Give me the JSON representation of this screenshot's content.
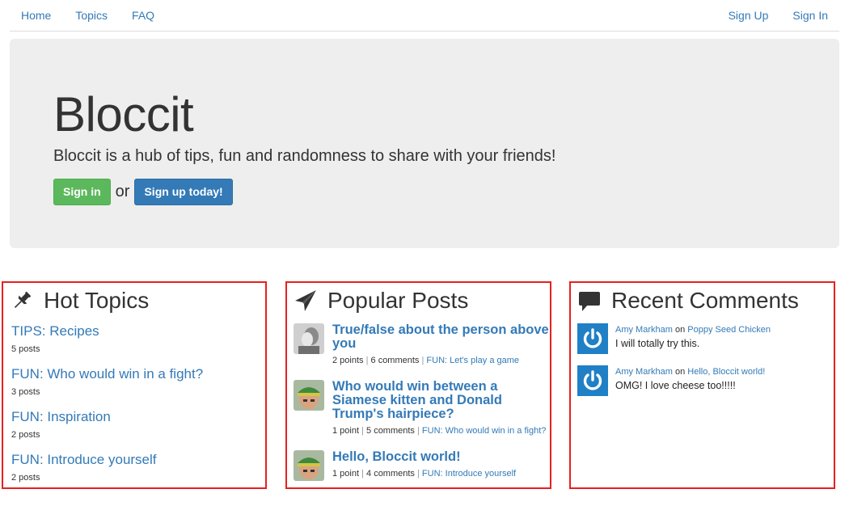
{
  "nav": {
    "left": [
      {
        "label": "Home"
      },
      {
        "label": "Topics"
      },
      {
        "label": "FAQ"
      }
    ],
    "right": [
      {
        "label": "Sign Up"
      },
      {
        "label": "Sign In"
      }
    ]
  },
  "hero": {
    "title": "Bloccit",
    "tagline": "Bloccit is a hub of tips, fun and randomness to share with your friends!",
    "sign_in_label": "Sign in",
    "or_text": "or",
    "sign_up_label": "Sign up today!"
  },
  "hot_topics": {
    "heading": "Hot Topics",
    "icon": "pushpin-icon",
    "items": [
      {
        "name": "TIPS: Recipes",
        "count": "5 posts"
      },
      {
        "name": "FUN: Who would win in a fight?",
        "count": "3 posts"
      },
      {
        "name": "FUN: Inspiration",
        "count": "2 posts"
      },
      {
        "name": "FUN: Introduce yourself",
        "count": "2 posts"
      }
    ]
  },
  "popular_posts": {
    "heading": "Popular Posts",
    "icon": "paper-plane-icon",
    "items": [
      {
        "title": "True/false about the person above you",
        "points": "2 points",
        "comments": "6 comments",
        "topic": "FUN: Let's play a game"
      },
      {
        "title": "Who would win between a Siamese kitten and Donald Trump's hairpiece?",
        "points": "1 point",
        "comments": "5 comments",
        "topic": "FUN: Who would win in a fight?"
      },
      {
        "title": "Hello, Bloccit world!",
        "points": "1 point",
        "comments": "4 comments",
        "topic": "FUN: Introduce yourself"
      }
    ]
  },
  "recent_comments": {
    "heading": "Recent Comments",
    "icon": "comment-icon",
    "on_text": "on",
    "items": [
      {
        "author": "Amy Markham",
        "post": "Poppy Seed Chicken",
        "body": "I will totally try this."
      },
      {
        "author": "Amy Markham",
        "post": "Hello, Bloccit world!",
        "body": "OMG! I love cheese too!!!!!"
      }
    ]
  },
  "colors": {
    "link": "#337ab7",
    "success": "#5cb85c",
    "primary": "#337ab7",
    "highlight_border": "#e62020",
    "jumbotron_bg": "#eeeeee",
    "avatar_blue": "#1f80c6"
  }
}
